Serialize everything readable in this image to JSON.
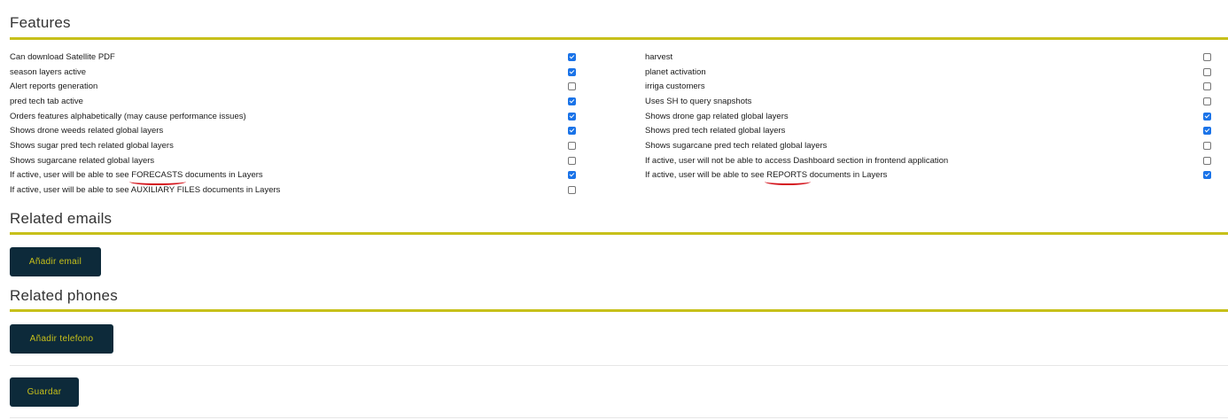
{
  "features": {
    "title": "Features",
    "left": [
      {
        "label": "Can download Satellite PDF",
        "checked": true
      },
      {
        "label": "season layers active",
        "checked": true
      },
      {
        "label": "Alert reports generation",
        "checked": false
      },
      {
        "label": "pred tech tab active",
        "checked": true
      },
      {
        "label": "Orders features alphabetically (may cause performance issues)",
        "checked": true
      },
      {
        "label": "Shows drone weeds related global layers",
        "checked": true
      },
      {
        "label": "Shows sugar pred tech related global layers",
        "checked": false
      },
      {
        "label": "Shows sugarcane related global layers",
        "checked": false
      },
      {
        "label_pre": "If active, user will be able to see ",
        "label_mark": "FORECASTS",
        "label_post": " documents in Layers",
        "checked": true
      },
      {
        "label": "If active, user will be able to see AUXILIARY FILES documents in Layers",
        "checked": false
      }
    ],
    "right": [
      {
        "label": "harvest",
        "checked": false
      },
      {
        "label": "planet activation",
        "checked": false
      },
      {
        "label": "irriga customers",
        "checked": false
      },
      {
        "label": "Uses SH to query snapshots",
        "checked": false
      },
      {
        "label": "Shows drone gap related global layers",
        "checked": true
      },
      {
        "label": "Shows pred tech related global layers",
        "checked": true
      },
      {
        "label": "Shows sugarcane pred tech related global layers",
        "checked": false
      },
      {
        "label": "If active, user will not be able to access Dashboard section in frontend application",
        "checked": false
      },
      {
        "label_pre": "If active, user will be able to see ",
        "label_mark": "REPORTS",
        "label_post": " documents in Layers",
        "checked": true
      }
    ]
  },
  "emails": {
    "title": "Related emails",
    "button_label": "Añadir email"
  },
  "phones": {
    "title": "Related phones",
    "button_label": "Añadir telefono"
  },
  "save_button_label": "Guardar",
  "colors": {
    "accent_rule": "#c7c01a",
    "button_bg": "#0d2a3a",
    "button_text": "#c7c01a",
    "checkbox_checked": "#1a73e8",
    "annotation_red": "#d4141c"
  }
}
